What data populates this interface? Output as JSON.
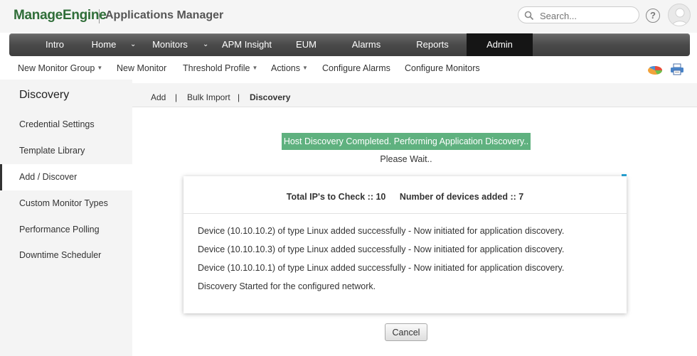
{
  "header": {
    "brand": "ManageEngine",
    "app_title": "Applications Manager",
    "search_placeholder": "Search...",
    "help_label": "?"
  },
  "main_nav": {
    "items": [
      {
        "label": "Intro"
      },
      {
        "label": "Home"
      },
      {
        "label": "Monitors"
      },
      {
        "label": "APM Insight"
      },
      {
        "label": "EUM"
      },
      {
        "label": "Alarms"
      },
      {
        "label": "Reports"
      },
      {
        "label": "Admin"
      }
    ],
    "active": "Admin",
    "chevron": "⌄"
  },
  "sub_nav": {
    "items": [
      {
        "label": "New Monitor Group",
        "dropdown": true
      },
      {
        "label": "New Monitor",
        "dropdown": false
      },
      {
        "label": "Threshold Profile",
        "dropdown": true
      },
      {
        "label": "Actions",
        "dropdown": true
      },
      {
        "label": "Configure Alarms",
        "dropdown": false
      },
      {
        "label": "Configure Monitors",
        "dropdown": false
      }
    ],
    "icons": [
      "chart-pie-icon",
      "printer-icon"
    ]
  },
  "sidebar": {
    "title": "Discovery",
    "items": [
      {
        "label": "Credential Settings"
      },
      {
        "label": "Template Library"
      },
      {
        "label": "Add / Discover"
      },
      {
        "label": "Custom Monitor Types"
      },
      {
        "label": "Performance Polling"
      },
      {
        "label": "Downtime Scheduler"
      }
    ],
    "active": "Add / Discover"
  },
  "tabs": {
    "items": [
      {
        "label": "Add"
      },
      {
        "label": "Bulk Import"
      },
      {
        "label": "Discovery"
      }
    ],
    "separator": "|",
    "active": "Discovery"
  },
  "discovery": {
    "status_banner": "Host Discovery Completed. Performing Application Discovery..",
    "wait_text": "Please Wait..",
    "total_ips": "Total IP's to Check :: 10",
    "devices_added": "Number of devices added :: 7",
    "log": [
      "Device (10.10.10.2) of type Linux added successfully - Now initiated for application discovery.",
      "Device (10.10.10.3) of type Linux added successfully - Now initiated for application discovery.",
      "Device (10.10.10.1) of type Linux added successfully - Now initiated for application discovery.",
      "Discovery Started for the configured network."
    ],
    "cancel_label": "Cancel"
  },
  "colors": {
    "brand_green": "#2f6d38",
    "banner_green": "#5fb17f",
    "nav_active": "#151515",
    "accent_blue": "#2aa6d8"
  }
}
